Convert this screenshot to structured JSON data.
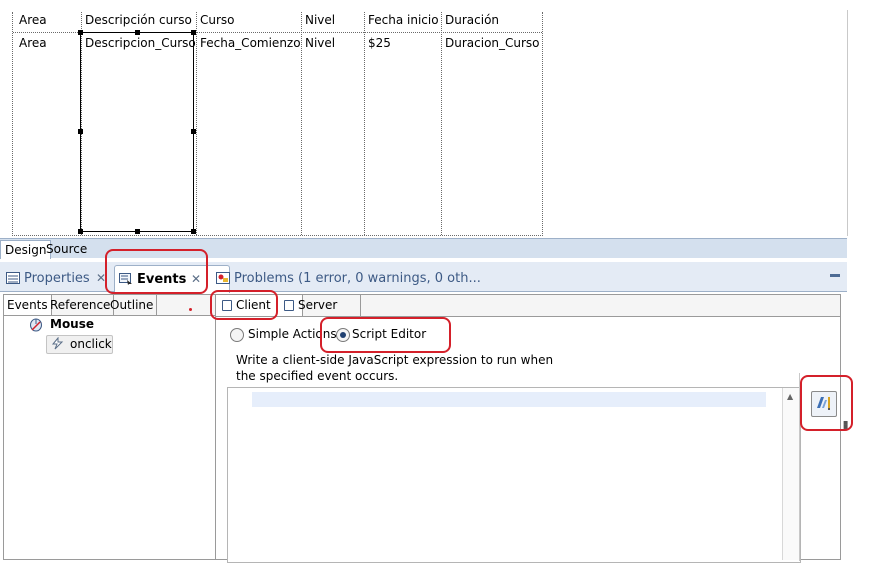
{
  "table": {
    "headers": [
      "Area",
      "Descripción curso",
      "Curso",
      "Nivel",
      "Fecha inicio",
      "Duración"
    ],
    "row": [
      "Area",
      "Descripcion_Curso",
      "Fecha_Comienzo",
      "Nivel",
      "$25",
      "Duracion_Curso"
    ]
  },
  "mode_tabs": {
    "design": "Design",
    "source": "Source"
  },
  "view_tabs": {
    "properties": "Properties",
    "events": "Events",
    "problems": "Problems (1 error, 0 warnings, 0 oth...",
    "close_glyph": "✕"
  },
  "left_panel": {
    "tabs": [
      "Events",
      "Reference",
      "Outline"
    ],
    "tree": {
      "group": "Mouse",
      "event": "onclick"
    }
  },
  "right_panel": {
    "tabs": {
      "client": "Client",
      "server": "Server"
    },
    "radio": {
      "simple_actions": "Simple Actions",
      "script_editor": "Script Editor",
      "selected": "script_editor"
    },
    "description": "Write a client-side JavaScript expression to run when the specified event occurs."
  },
  "colors": {
    "annotation_red": "#d4202a",
    "tab_blue": "#3d5a85",
    "bar_bg": "#e4ebf5"
  }
}
